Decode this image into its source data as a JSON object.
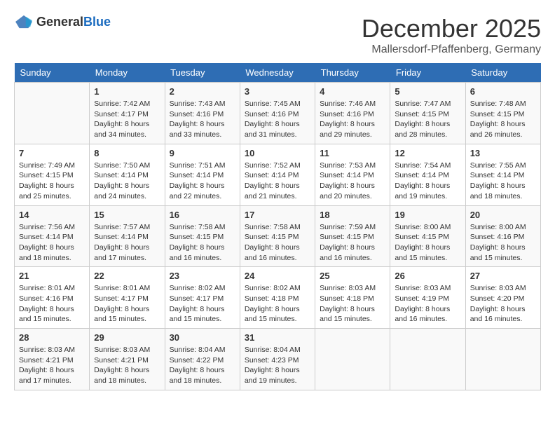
{
  "header": {
    "logo_general": "General",
    "logo_blue": "Blue",
    "title": "December 2025",
    "location": "Mallersdorf-Pfaffenberg, Germany"
  },
  "days_of_week": [
    "Sunday",
    "Monday",
    "Tuesday",
    "Wednesday",
    "Thursday",
    "Friday",
    "Saturday"
  ],
  "weeks": [
    [
      {
        "day": "",
        "info": ""
      },
      {
        "day": "1",
        "info": "Sunrise: 7:42 AM\nSunset: 4:17 PM\nDaylight: 8 hours\nand 34 minutes."
      },
      {
        "day": "2",
        "info": "Sunrise: 7:43 AM\nSunset: 4:16 PM\nDaylight: 8 hours\nand 33 minutes."
      },
      {
        "day": "3",
        "info": "Sunrise: 7:45 AM\nSunset: 4:16 PM\nDaylight: 8 hours\nand 31 minutes."
      },
      {
        "day": "4",
        "info": "Sunrise: 7:46 AM\nSunset: 4:16 PM\nDaylight: 8 hours\nand 29 minutes."
      },
      {
        "day": "5",
        "info": "Sunrise: 7:47 AM\nSunset: 4:15 PM\nDaylight: 8 hours\nand 28 minutes."
      },
      {
        "day": "6",
        "info": "Sunrise: 7:48 AM\nSunset: 4:15 PM\nDaylight: 8 hours\nand 26 minutes."
      }
    ],
    [
      {
        "day": "7",
        "info": "Sunrise: 7:49 AM\nSunset: 4:15 PM\nDaylight: 8 hours\nand 25 minutes."
      },
      {
        "day": "8",
        "info": "Sunrise: 7:50 AM\nSunset: 4:14 PM\nDaylight: 8 hours\nand 24 minutes."
      },
      {
        "day": "9",
        "info": "Sunrise: 7:51 AM\nSunset: 4:14 PM\nDaylight: 8 hours\nand 22 minutes."
      },
      {
        "day": "10",
        "info": "Sunrise: 7:52 AM\nSunset: 4:14 PM\nDaylight: 8 hours\nand 21 minutes."
      },
      {
        "day": "11",
        "info": "Sunrise: 7:53 AM\nSunset: 4:14 PM\nDaylight: 8 hours\nand 20 minutes."
      },
      {
        "day": "12",
        "info": "Sunrise: 7:54 AM\nSunset: 4:14 PM\nDaylight: 8 hours\nand 19 minutes."
      },
      {
        "day": "13",
        "info": "Sunrise: 7:55 AM\nSunset: 4:14 PM\nDaylight: 8 hours\nand 18 minutes."
      }
    ],
    [
      {
        "day": "14",
        "info": "Sunrise: 7:56 AM\nSunset: 4:14 PM\nDaylight: 8 hours\nand 18 minutes."
      },
      {
        "day": "15",
        "info": "Sunrise: 7:57 AM\nSunset: 4:14 PM\nDaylight: 8 hours\nand 17 minutes."
      },
      {
        "day": "16",
        "info": "Sunrise: 7:58 AM\nSunset: 4:15 PM\nDaylight: 8 hours\nand 16 minutes."
      },
      {
        "day": "17",
        "info": "Sunrise: 7:58 AM\nSunset: 4:15 PM\nDaylight: 8 hours\nand 16 minutes."
      },
      {
        "day": "18",
        "info": "Sunrise: 7:59 AM\nSunset: 4:15 PM\nDaylight: 8 hours\nand 16 minutes."
      },
      {
        "day": "19",
        "info": "Sunrise: 8:00 AM\nSunset: 4:15 PM\nDaylight: 8 hours\nand 15 minutes."
      },
      {
        "day": "20",
        "info": "Sunrise: 8:00 AM\nSunset: 4:16 PM\nDaylight: 8 hours\nand 15 minutes."
      }
    ],
    [
      {
        "day": "21",
        "info": "Sunrise: 8:01 AM\nSunset: 4:16 PM\nDaylight: 8 hours\nand 15 minutes."
      },
      {
        "day": "22",
        "info": "Sunrise: 8:01 AM\nSunset: 4:17 PM\nDaylight: 8 hours\nand 15 minutes."
      },
      {
        "day": "23",
        "info": "Sunrise: 8:02 AM\nSunset: 4:17 PM\nDaylight: 8 hours\nand 15 minutes."
      },
      {
        "day": "24",
        "info": "Sunrise: 8:02 AM\nSunset: 4:18 PM\nDaylight: 8 hours\nand 15 minutes."
      },
      {
        "day": "25",
        "info": "Sunrise: 8:03 AM\nSunset: 4:18 PM\nDaylight: 8 hours\nand 15 minutes."
      },
      {
        "day": "26",
        "info": "Sunrise: 8:03 AM\nSunset: 4:19 PM\nDaylight: 8 hours\nand 16 minutes."
      },
      {
        "day": "27",
        "info": "Sunrise: 8:03 AM\nSunset: 4:20 PM\nDaylight: 8 hours\nand 16 minutes."
      }
    ],
    [
      {
        "day": "28",
        "info": "Sunrise: 8:03 AM\nSunset: 4:21 PM\nDaylight: 8 hours\nand 17 minutes."
      },
      {
        "day": "29",
        "info": "Sunrise: 8:03 AM\nSunset: 4:21 PM\nDaylight: 8 hours\nand 18 minutes."
      },
      {
        "day": "30",
        "info": "Sunrise: 8:04 AM\nSunset: 4:22 PM\nDaylight: 8 hours\nand 18 minutes."
      },
      {
        "day": "31",
        "info": "Sunrise: 8:04 AM\nSunset: 4:23 PM\nDaylight: 8 hours\nand 19 minutes."
      },
      {
        "day": "",
        "info": ""
      },
      {
        "day": "",
        "info": ""
      },
      {
        "day": "",
        "info": ""
      }
    ]
  ]
}
